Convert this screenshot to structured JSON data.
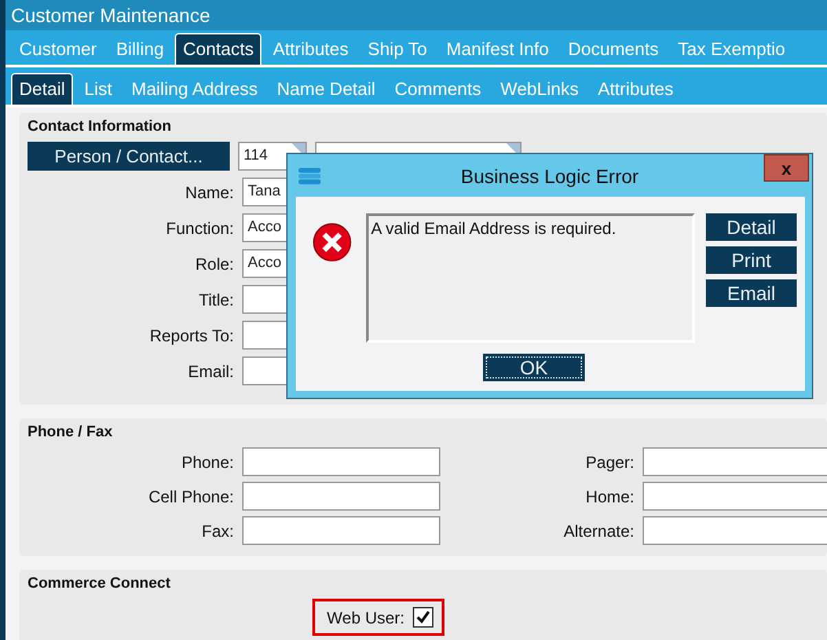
{
  "window": {
    "title": "Customer Maintenance"
  },
  "tabs": [
    {
      "label": "Customer",
      "selected": false
    },
    {
      "label": "Billing",
      "selected": false
    },
    {
      "label": "Contacts",
      "selected": true
    },
    {
      "label": "Attributes",
      "selected": false
    },
    {
      "label": "Ship To",
      "selected": false
    },
    {
      "label": "Manifest Info",
      "selected": false
    },
    {
      "label": "Documents",
      "selected": false
    },
    {
      "label": "Tax Exemptio",
      "selected": false
    }
  ],
  "subtabs": [
    {
      "label": "Detail",
      "selected": true
    },
    {
      "label": "List",
      "selected": false
    },
    {
      "label": "Mailing Address",
      "selected": false
    },
    {
      "label": "Name Detail",
      "selected": false
    },
    {
      "label": "Comments",
      "selected": false
    },
    {
      "label": "WebLinks",
      "selected": false
    },
    {
      "label": "Attributes",
      "selected": false
    }
  ],
  "contact_information": {
    "heading": "Contact Information",
    "person_button": "Person / Contact...",
    "person_id": "114",
    "fields": [
      {
        "label": "Name:",
        "value": "Tana"
      },
      {
        "label": "Function:",
        "value": "Acco"
      },
      {
        "label": "Role:",
        "value": "Acco"
      },
      {
        "label": "Title:"
      },
      {
        "label": "Reports To:"
      },
      {
        "label": "Email:"
      }
    ]
  },
  "phone_fax": {
    "heading": "Phone / Fax",
    "left": [
      {
        "label": "Phone:"
      },
      {
        "label": "Cell Phone:"
      },
      {
        "label": "Fax:"
      }
    ],
    "right": [
      {
        "label": "Pager:"
      },
      {
        "label": "Home:"
      },
      {
        "label": "Alternate:"
      }
    ]
  },
  "commerce_connect": {
    "heading": "Commerce Connect",
    "web_user": {
      "label": "Web User:",
      "checked": true
    }
  },
  "dialog": {
    "title": "Business Logic Error",
    "close": "x",
    "message": "A valid Email Address is required.",
    "buttons": [
      "Detail",
      "Print",
      "Email"
    ],
    "ok": "OK"
  }
}
